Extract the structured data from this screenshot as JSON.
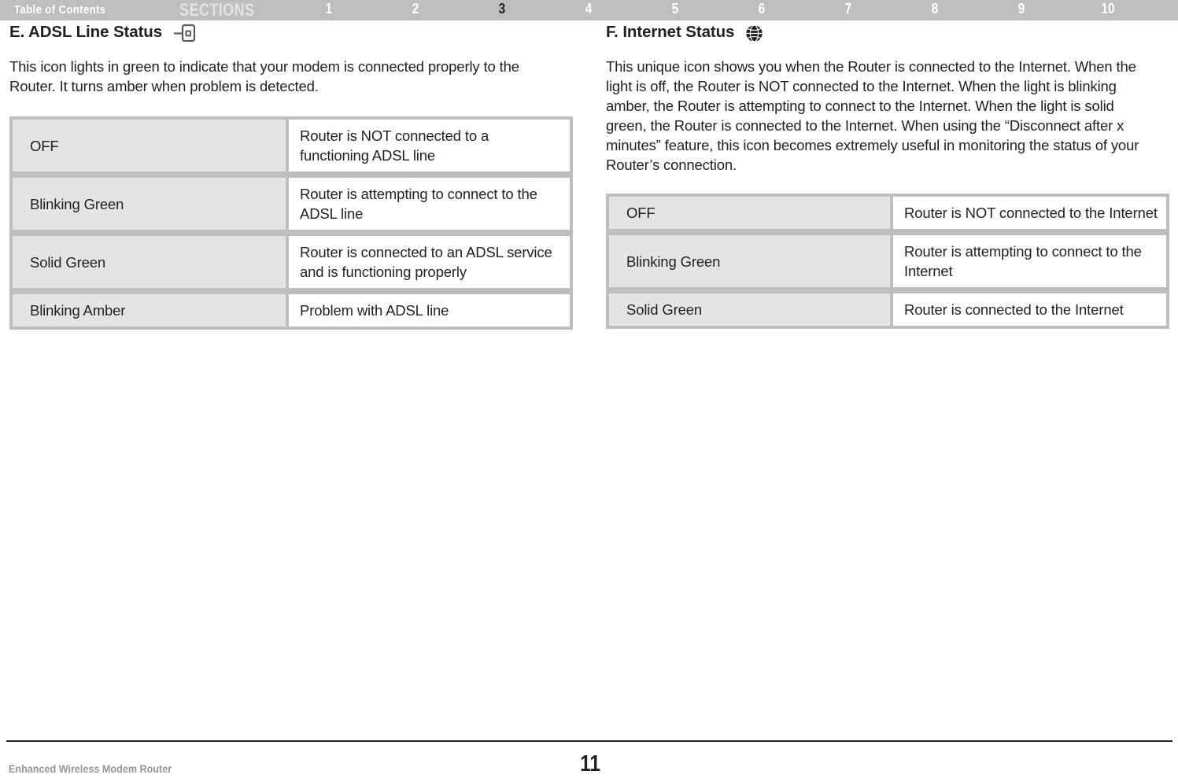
{
  "top_nav": {
    "table_of_contents_label": "Table of Contents",
    "sections_label": "SECTIONS",
    "section_numbers": [
      "1",
      "2",
      "3",
      "4",
      "5",
      "6",
      "7",
      "8",
      "9",
      "10"
    ],
    "active_section": "3",
    "bar_color": "#bcbec0",
    "label_color": "#ffffff",
    "active_color": "#231f20"
  },
  "left_column": {
    "heading_text": "E. ADSL Line Status",
    "heading_icon": "adsl-line-jack-icon",
    "paragraph": "This icon lights in green to indicate that your modem is connected properly to the Router. It turns amber when problem is detected.",
    "table": {
      "rows": [
        {
          "state": "OFF",
          "description": "Router is NOT connected to a functioning ADSL line"
        },
        {
          "state": "Blinking Green",
          "description": "Router is attempting to connect to the ADSL line"
        },
        {
          "state": "Solid Green",
          "description": "Router is connected to an ADSL service and is functioning properly"
        },
        {
          "state": "Blinking Amber",
          "description": "Problem with ADSL line"
        }
      ]
    }
  },
  "right_column": {
    "heading_text": "F. Internet Status",
    "heading_icon": "globe-internet-icon",
    "paragraph": "This unique icon shows you when the Router is connected to the Internet. When the light is off, the Router is NOT connected to the Internet. When the light is blinking amber, the Router is attempting to connect to the Internet. When the light is solid green, the Router is connected to the Internet. When using the “Disconnect after x minutes” feature, this icon becomes extremely useful in monitoring the status of your Router’s connection.",
    "table": {
      "rows": [
        {
          "state": "OFF",
          "description": "Router is NOT connected to the Internet"
        },
        {
          "state": "Blinking Green",
          "description": "Router is attempting to connect to the Internet"
        },
        {
          "state": "Solid Green",
          "description": "Router is connected to the Internet"
        }
      ]
    }
  },
  "footer": {
    "document_title": "Enhanced Wireless Modem Router",
    "page_number": "11",
    "title_color": "#939598"
  }
}
